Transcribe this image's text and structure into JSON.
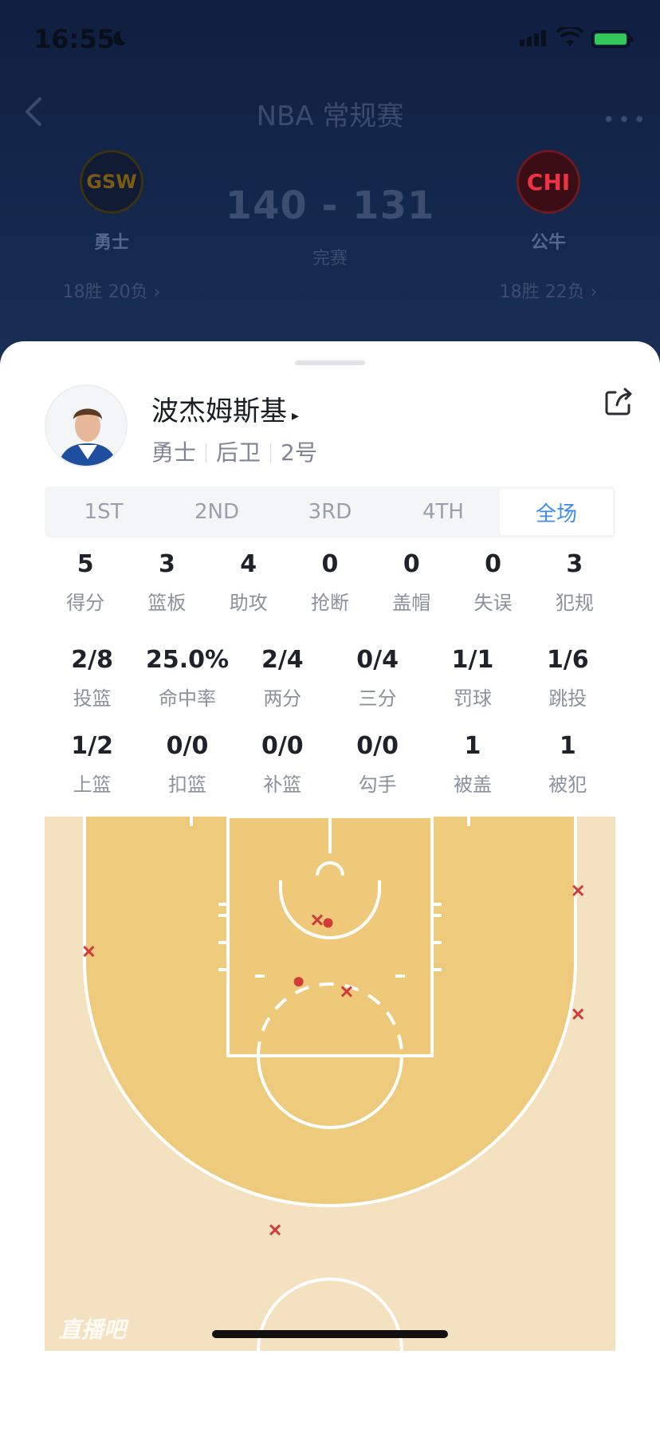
{
  "status_bar": {
    "time": "16:55"
  },
  "header": {
    "title": "NBA 常规赛",
    "home": {
      "abbr": "GSW",
      "name": "勇士",
      "record": "18胜 20负 ›"
    },
    "away": {
      "abbr": "CHI",
      "name": "公牛",
      "record": "18胜 22负 ›"
    },
    "score": "140 - 131",
    "status": "完赛"
  },
  "player": {
    "name": "波杰姆斯基",
    "arrow": "▸",
    "team": "勇士",
    "position": "后卫",
    "number": "2号"
  },
  "period_tabs": [
    {
      "label": "1ST",
      "active": false
    },
    {
      "label": "2ND",
      "active": false
    },
    {
      "label": "3RD",
      "active": false
    },
    {
      "label": "4TH",
      "active": false
    },
    {
      "label": "全场",
      "active": true
    }
  ],
  "basic_stats": [
    {
      "value": "5",
      "label": "得分"
    },
    {
      "value": "3",
      "label": "篮板"
    },
    {
      "value": "4",
      "label": "助攻"
    },
    {
      "value": "0",
      "label": "抢断"
    },
    {
      "value": "0",
      "label": "盖帽"
    },
    {
      "value": "0",
      "label": "失误"
    },
    {
      "value": "3",
      "label": "犯规"
    }
  ],
  "shooting_stats": [
    {
      "value": "2/8",
      "label": "投篮"
    },
    {
      "value": "25.0%",
      "label": "命中率"
    },
    {
      "value": "2/4",
      "label": "两分"
    },
    {
      "value": "0/4",
      "label": "三分"
    },
    {
      "value": "1/1",
      "label": "罚球"
    },
    {
      "value": "1/6",
      "label": "跳投"
    }
  ],
  "shot_type_stats": [
    {
      "value": "1/2",
      "label": "上篮"
    },
    {
      "value": "0/0",
      "label": "扣篮"
    },
    {
      "value": "0/0",
      "label": "补篮"
    },
    {
      "value": "0/0",
      "label": "勾手"
    },
    {
      "value": "1",
      "label": "被盖"
    },
    {
      "value": "1",
      "label": "被犯"
    }
  ],
  "shot_chart": {
    "made_color": "#d33a3a",
    "missed_color": "#d33a3a",
    "shots": [
      {
        "result": "made",
        "x_ft": -0.2,
        "y_ft": 5.8
      },
      {
        "result": "missed",
        "x_ft": -1.3,
        "y_ft": 5.5
      },
      {
        "result": "made",
        "x_ft": -3.2,
        "y_ft": 11.8
      },
      {
        "result": "missed",
        "x_ft": 1.7,
        "y_ft": 12.8
      },
      {
        "result": "missed",
        "x_ft": -24.6,
        "y_ft": 8.7
      },
      {
        "result": "missed",
        "x_ft": 25.3,
        "y_ft": 2.5
      },
      {
        "result": "missed",
        "x_ft": 25.3,
        "y_ft": 15.1
      },
      {
        "result": "missed",
        "x_ft": -5.6,
        "y_ft": 37.1
      }
    ],
    "watermark": "直播吧"
  }
}
